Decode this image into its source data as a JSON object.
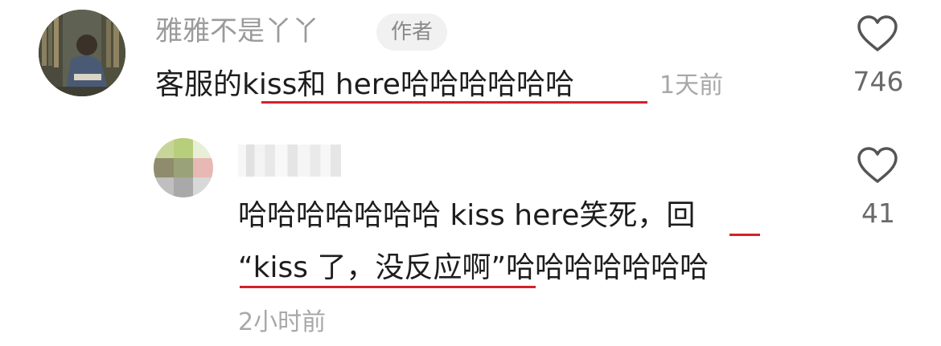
{
  "comment": {
    "username": "雅雅不是丫丫",
    "badge": "作者",
    "text_prefix": "客服的",
    "text_underlined": "kiss和 here哈哈哈哈哈哈",
    "time": "1天前",
    "like_count": "746"
  },
  "reply": {
    "username": "",
    "line1_text": "哈哈哈哈哈哈哈 kiss here笑死，",
    "line1_underlined": "回",
    "line2_underlined": "“kiss 了，没反应啊”",
    "line2_text": "哈哈哈哈哈哈哈",
    "time": "2小时前",
    "like_count": "41"
  },
  "colors": {
    "underline": "#d6202b",
    "text": "#1d1d1d",
    "muted": "#9b9b9b"
  },
  "icons": [
    "heart-icon"
  ]
}
